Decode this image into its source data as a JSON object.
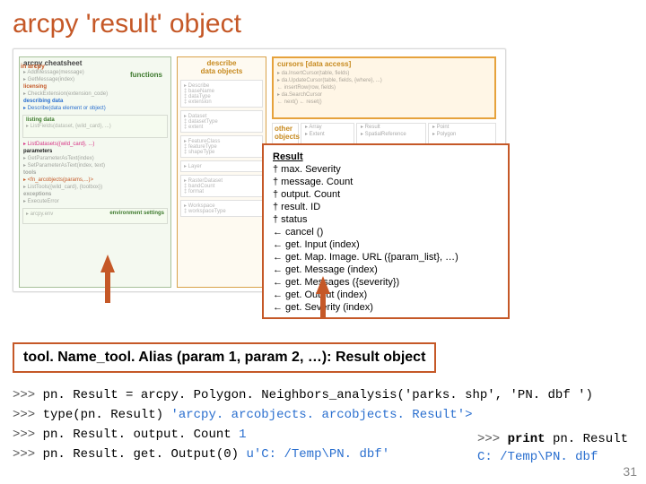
{
  "title": "arcpy 'result' object",
  "cheatsheet": {
    "header_left": "arcpy cheatsheet",
    "header_mid_top": "describe",
    "header_mid_bot": "data objects",
    "header_right": "cursors [data access]",
    "left_tag": "in arcpy",
    "left_functions": "functions",
    "left_environment": "environment settings",
    "other_objects": "other objects"
  },
  "result_box": {
    "header": "Result",
    "lines": [
      "† max. Severity",
      "† message. Count",
      "† output. Count",
      "† result. ID",
      "† status",
      "← cancel ()",
      "← get. Input (index)",
      "← get. Map. Image. URL ({param_list}, …)",
      "← get. Message (index)",
      "← get. Messages ({severity})",
      "← get. Output (index)",
      "← get. Severity (index)"
    ]
  },
  "signature": "tool. Name_tool. Alias (param 1, param 2, …): Result object",
  "code": {
    "l1": "pn. Result = arcpy. Polygon. Neighbors_analysis('parks. shp', 'PN. dbf ')",
    "l2a": "type(pn. Result)",
    "l2b": "'arcpy. arcobjects. arcobjects. Result'>",
    "l3a": "pn. Result. output. Count",
    "l3b": "1",
    "l4a": "pn. Result. get. Output(0)",
    "l4b": "u'C: /Temp\\PN. dbf'",
    "print_stmt": "pn. Result",
    "print_kw": "print",
    "print_out": "C: /Temp\\PN. dbf"
  },
  "prompt": ">>>",
  "page": "31"
}
